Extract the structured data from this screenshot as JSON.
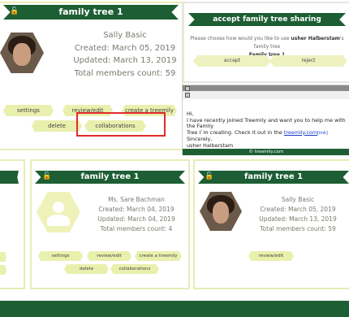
{
  "card_top": {
    "title": "family tree 1",
    "name": "Sally Basic",
    "created": "Created: March 05, 2019",
    "updated": "Updated: March 13, 2019",
    "members": "Total members count: 59",
    "buttons": {
      "settings": "settings",
      "review_edit": "review/edit",
      "create": "create a treemily",
      "delete": "delete",
      "collaborations": "collaborations"
    }
  },
  "accept_dialog": {
    "title": "accept family tree sharing",
    "message_pre": "Please choose how would you like to use ",
    "message_user": "usher Halberstam",
    "message_post": "'s family tree",
    "tree_name": "Family tree 1",
    "accept": "accept",
    "reject": "reject"
  },
  "email": {
    "greeting": "Hi,",
    "line1": "I have recently joined Treemily and want you to help me with the Family",
    "line2_pre": "Tree I`m creating. Check it out in the ",
    "link": "treemily.com",
    "link_extra": "[link]",
    "sign1": "Sincerely,",
    "sign2": "usher Halberstam",
    "footer": "© treemily.com"
  },
  "card_mid": {
    "title": "family tree 1",
    "name": "Ms. Sare Bachman",
    "created": "Created: March 04, 2019",
    "updated": "Updated: March 04, 2019",
    "members": "Total members count: 4",
    "buttons": {
      "settings": "settings",
      "review_edit": "review/edit",
      "create": "create a treemily",
      "delete": "delete",
      "collaborations": "collaborations"
    }
  },
  "card_right": {
    "title": "family tree 1",
    "name": "Sally Basic",
    "created": "Created: March 05, 2019",
    "updated": "Updated: March 13, 2019",
    "members": "Total members count: 59",
    "buttons": {
      "review_edit": "review/edit"
    }
  },
  "colors": {
    "brand_green": "#1d5e34",
    "pill_yellow": "#e9f0ad",
    "highlight_red": "#e12b2b"
  }
}
